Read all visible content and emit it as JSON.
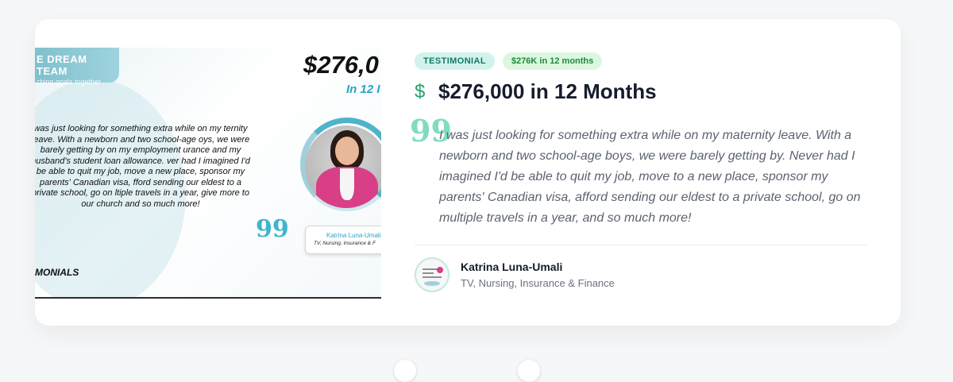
{
  "colors": {
    "accent_teal": "#167866",
    "badge_teal_bg": "#d2f3ec",
    "badge_green_bg": "#dcf7df",
    "dollar_green": "#22a36c",
    "quote_mint": "#7fdcc1",
    "heading": "#151c2c"
  },
  "promo_image": {
    "team_name": "E DREAM TEAM",
    "team_tagline": "ching goals together",
    "amount": "$276,0",
    "period": "In 12 I",
    "quote": "was just looking for something extra while on my ternity leave. With a newborn and two school-age oys, we were barely getting by on my employment urance and my husband's student loan allowance. ver had I imagined I'd be able to quit my job, move a new place, sponsor my parents'  Canadian visa, fford sending our eldest to a private school, go on ltiple travels in a year, give more to our church and so much more!",
    "quote_mark": "99",
    "footer_label": "MONIALS",
    "name_card": {
      "name": "Katrina Luna-Umali",
      "role": "TV, Nursing, Insurance & F"
    }
  },
  "testimonial": {
    "badge_type": "TESTIMONIAL",
    "badge_result": "$276K in 12 months",
    "dollar_symbol": "$",
    "headline": "$276,000 in 12 Months",
    "quote_mark": "99",
    "quote": "I was just looking for something extra while on my maternity leave. With a newborn and two school-age boys, we were barely getting by. Never had I imagined I'd be able to quit my job, move to a new place, sponsor my parents' Canadian visa, afford sending our eldest to a private school, go on multiple travels in a year, and so much more!",
    "author": {
      "name": "Katrina Luna-Umali",
      "role": "TV, Nursing, Insurance & Finance"
    }
  }
}
